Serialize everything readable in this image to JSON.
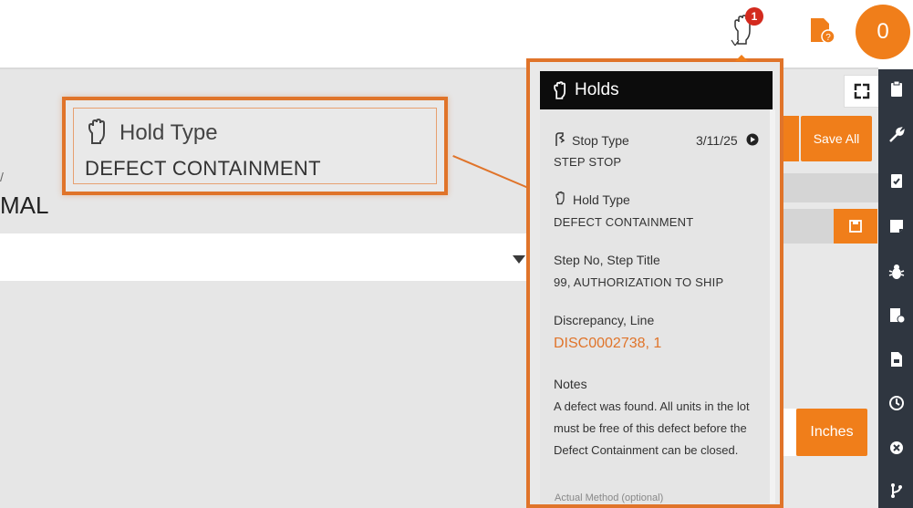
{
  "topbar": {
    "notification_count": "1",
    "avatar_label": "0"
  },
  "background": {
    "slash_text": "/",
    "partial_title": "MAL"
  },
  "callout": {
    "title": "Hold Type",
    "value": "DEFECT CONTAINMENT"
  },
  "right_controls": {
    "save_all_label": "Save All",
    "units_label": "Inches"
  },
  "holds_popup": {
    "header": "Holds",
    "stop_type_label": "Stop Type",
    "stop_type_date": "3/11/25",
    "stop_type_value": "STEP STOP",
    "hold_type_label": "Hold Type",
    "hold_type_value": "DEFECT CONTAINMENT",
    "step_label": "Step No, Step Title",
    "step_value": "99, AUTHORIZATION TO SHIP",
    "discrepancy_label": "Discrepancy, Line",
    "discrepancy_value": "DISC0002738, 1",
    "notes_label": "Notes",
    "notes_value": "A defect was found. All units in the lot must be free of this defect before the Defect Containment can be closed.",
    "footer_fade": "Actual Method (optional)"
  },
  "sidebar": {
    "icons": [
      "clipboard-icon",
      "wrench-icon",
      "clipboard-check-icon",
      "note-icon",
      "bug-icon",
      "doc-info-icon",
      "doc-icon",
      "clock-icon",
      "close-circle-icon",
      "branch-icon"
    ]
  },
  "colors": {
    "accent": "#f07e1a",
    "highlight_border": "#e0742a",
    "sidebar": "#2f3640",
    "badge": "#d32a1e"
  }
}
